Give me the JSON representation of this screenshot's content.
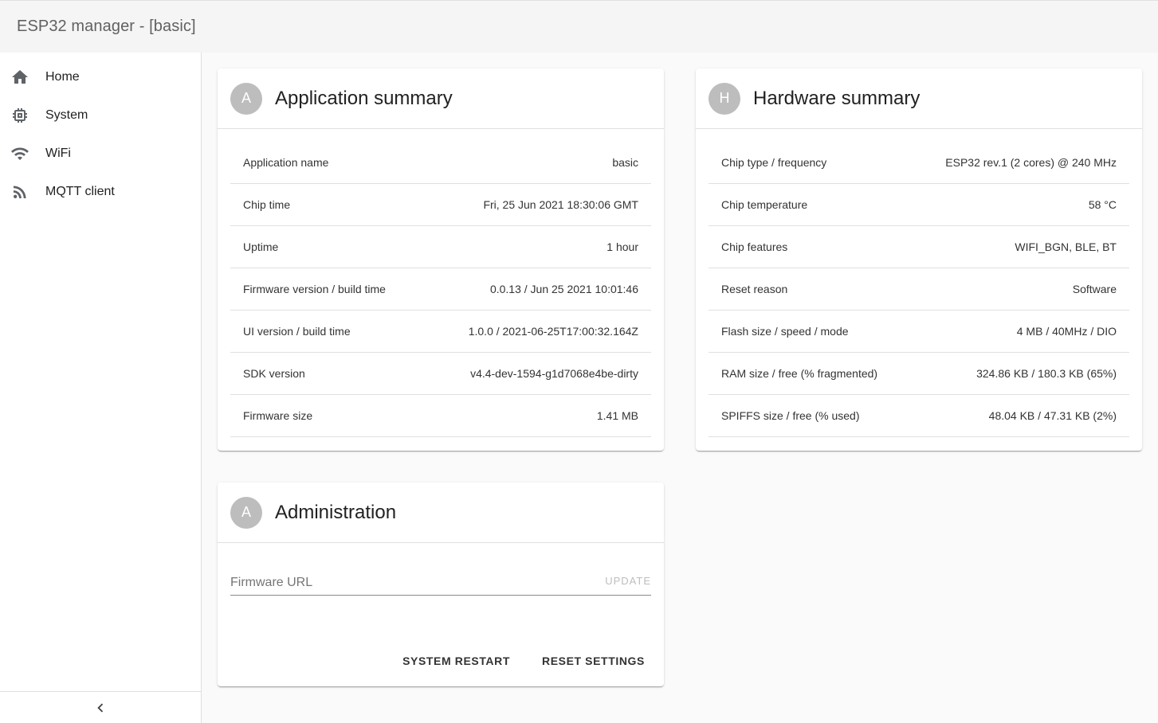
{
  "app": {
    "title": "ESP32 manager - [basic]"
  },
  "sidebar": {
    "items": [
      {
        "label": "Home",
        "icon": "home-icon"
      },
      {
        "label": "System",
        "icon": "chip-icon"
      },
      {
        "label": "WiFi",
        "icon": "wifi-icon"
      },
      {
        "label": "MQTT client",
        "icon": "rss-icon"
      }
    ],
    "collapse_icon": "chevron-left-icon"
  },
  "application_summary": {
    "avatar": "A",
    "title": "Application summary",
    "rows": [
      {
        "label": "Application name",
        "value": "basic"
      },
      {
        "label": "Chip time",
        "value": "Fri, 25 Jun 2021 18:30:06 GMT"
      },
      {
        "label": "Uptime",
        "value": "1 hour"
      },
      {
        "label": "Firmware version / build time",
        "value": "0.0.13 / Jun 25 2021 10:01:46"
      },
      {
        "label": "UI version / build time",
        "value": "1.0.0 / 2021-06-25T17:00:32.164Z"
      },
      {
        "label": "SDK version",
        "value": "v4.4-dev-1594-g1d7068e4be-dirty"
      },
      {
        "label": "Firmware size",
        "value": "1.41 MB"
      }
    ]
  },
  "hardware_summary": {
    "avatar": "H",
    "title": "Hardware summary",
    "rows": [
      {
        "label": "Chip type / frequency",
        "value": "ESP32 rev.1 (2 cores) @ 240 MHz"
      },
      {
        "label": "Chip temperature",
        "value": "58 °C"
      },
      {
        "label": "Chip features",
        "value": "WIFI_BGN, BLE, BT"
      },
      {
        "label": "Reset reason",
        "value": "Software"
      },
      {
        "label": "Flash size / speed / mode",
        "value": "4 MB / 40MHz / DIO"
      },
      {
        "label": "RAM size / free (% fragmented)",
        "value": "324.86 KB / 180.3 KB (65%)"
      },
      {
        "label": "SPIFFS size / free (% used)",
        "value": "48.04 KB / 47.31 KB (2%)"
      }
    ]
  },
  "administration": {
    "avatar": "A",
    "title": "Administration",
    "firmware_url": {
      "placeholder": "Firmware URL",
      "value": ""
    },
    "update_label": "UPDATE",
    "restart_label": "SYSTEM RESTART",
    "reset_label": "RESET SETTINGS"
  },
  "colors": {
    "avatar_bg": "#bdbdbd",
    "appbar_bg": "#f5f5f5",
    "page_bg": "#fafafa"
  }
}
